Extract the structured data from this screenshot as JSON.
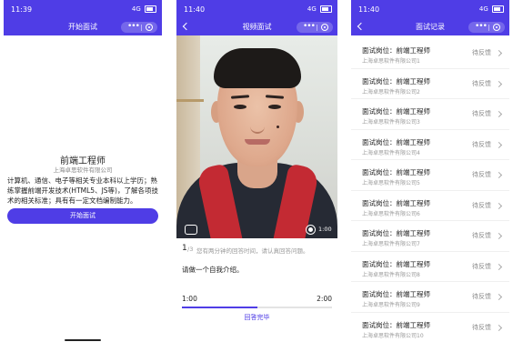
{
  "screens": {
    "start": {
      "time": "11:39",
      "network": "4G",
      "title": "开始面试",
      "job_title": "前端工程师",
      "company": "上海卓思软件有限公司",
      "description": "计算机、通信、电子等相关专业本科以上学历；熟练掌握前端开发技术(HTML5、JS等)，了解各项技术的相关标准；具有有一定文档编制能力。",
      "start_button": "开始面试"
    },
    "video": {
      "time": "11:40",
      "network": "4G",
      "title": "视频面试",
      "record_time": "1:00",
      "question_number": "1",
      "question_total": "/3",
      "hint": "您有两分钟的回答时间，请认真回答问题。",
      "question": "请做一个自我介绍。",
      "progress_start": "1:00",
      "progress_end": "2:00",
      "progress_fraction": 0.5,
      "finish_link": "回答完毕"
    },
    "records": {
      "time": "11:40",
      "network": "4G",
      "title": "面试记录",
      "items": [
        {
          "title": "面试岗位：前端工程师",
          "company": "上海卓思软件有限公司1",
          "status": "待反馈"
        },
        {
          "title": "面试岗位：前端工程师",
          "company": "上海卓思软件有限公司2",
          "status": "待反馈"
        },
        {
          "title": "面试岗位：前端工程师",
          "company": "上海卓思软件有限公司3",
          "status": "待反馈"
        },
        {
          "title": "面试岗位：前端工程师",
          "company": "上海卓思软件有限公司4",
          "status": "待反馈"
        },
        {
          "title": "面试岗位：前端工程师",
          "company": "上海卓思软件有限公司5",
          "status": "待反馈"
        },
        {
          "title": "面试岗位：前端工程师",
          "company": "上海卓思软件有限公司6",
          "status": "待反馈"
        },
        {
          "title": "面试岗位：前端工程师",
          "company": "上海卓思软件有限公司7",
          "status": "待反馈"
        },
        {
          "title": "面试岗位：前端工程师",
          "company": "上海卓思软件有限公司8",
          "status": "待反馈"
        },
        {
          "title": "面试岗位：前端工程师",
          "company": "上海卓思软件有限公司9",
          "status": "待反馈"
        },
        {
          "title": "面试岗位：前端工程师",
          "company": "上海卓思软件有限公司10",
          "status": "待反馈"
        }
      ]
    }
  },
  "colors": {
    "accent": "#4f3de6",
    "status_text": "#888888"
  },
  "icons": [
    "back-icon",
    "more-icon",
    "close-circle-icon",
    "camera-switch-icon",
    "record-icon",
    "chevron-right-icon",
    "battery-icon"
  ]
}
